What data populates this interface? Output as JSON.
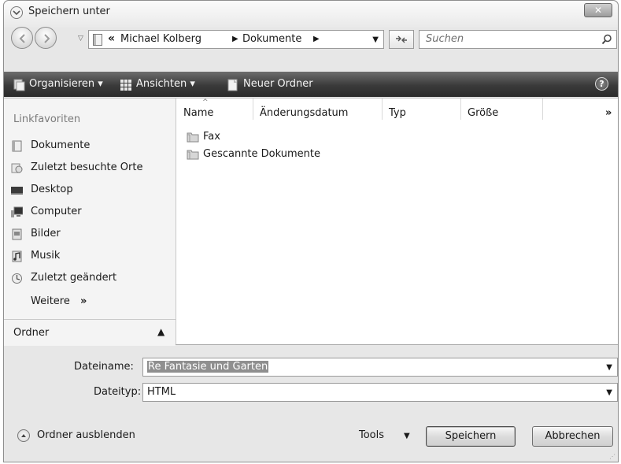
{
  "window": {
    "title": "Speichern unter",
    "close_label": "✕"
  },
  "address": {
    "overflow_label": "«",
    "crumbs": [
      "Michael Kolberg",
      "Dokumente"
    ],
    "search_placeholder": "Suchen"
  },
  "toolbar": {
    "organize_label": "Organisieren ▾",
    "views_label": "Ansichten ▾",
    "new_folder_label": "Neuer Ordner",
    "help_label": "?"
  },
  "sidebar": {
    "heading": "Linkfavoriten",
    "items": [
      {
        "label": "Dokumente",
        "icon": "documents-icon"
      },
      {
        "label": "Zuletzt besuchte Orte",
        "icon": "recent-places-icon"
      },
      {
        "label": "Desktop",
        "icon": "desktop-icon"
      },
      {
        "label": "Computer",
        "icon": "computer-icon"
      },
      {
        "label": "Bilder",
        "icon": "pictures-icon"
      },
      {
        "label": "Musik",
        "icon": "music-icon"
      },
      {
        "label": "Zuletzt geändert",
        "icon": "recently-changed-icon"
      }
    ],
    "more_label": "Weitere",
    "more_arrow": "»",
    "folders_label": "Ordner",
    "folders_caret": "▲"
  },
  "filelist": {
    "columns": [
      "Name",
      "Änderungsdatum",
      "Typ",
      "Größe"
    ],
    "more_columns": "»",
    "rows": [
      {
        "name": "Fax"
      },
      {
        "name": "Gescannte Dokumente"
      }
    ]
  },
  "form": {
    "filename_label": "Dateiname:",
    "filename_value": "Re Fantasie und Garten",
    "filetype_label": "Dateityp:",
    "filetype_value": "HTML"
  },
  "footer": {
    "collapse_label": "Ordner ausblenden",
    "tools_label": "Tools",
    "save_label": "Speichern",
    "cancel_label": "Abbrechen"
  }
}
